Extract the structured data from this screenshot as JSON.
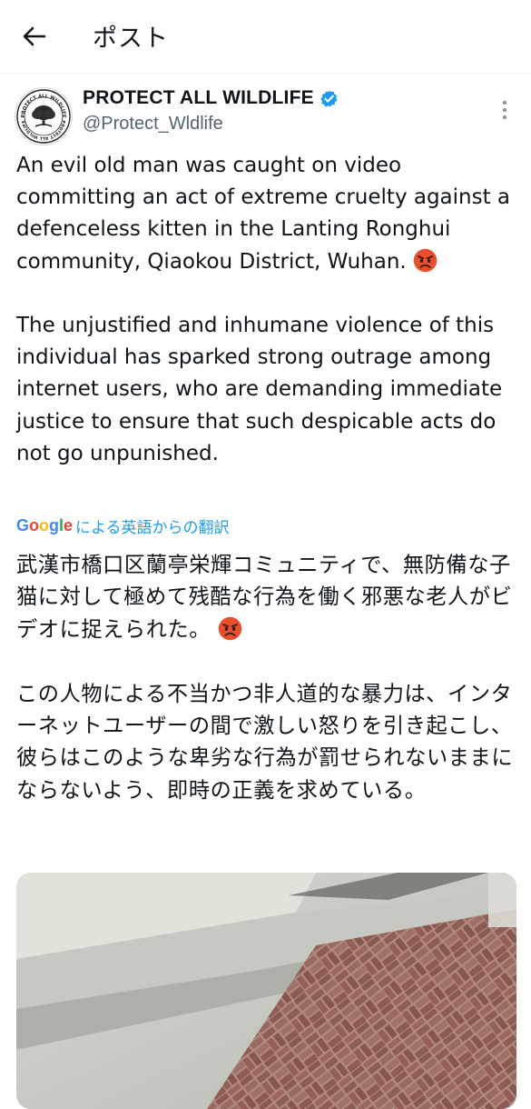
{
  "header": {
    "title": "ポスト"
  },
  "author": {
    "name": "PROTECT ALL WILDLIFE",
    "handle": "@Protect_Wldlife",
    "verified": true,
    "verified_color": "#1d9bf0",
    "avatar_seal_text": "PROTECT ALL WILDLIFE"
  },
  "post": {
    "paragraph1": "An evil old man was caught on video committing an act of extreme cruelty against a defenceless kitten in the Lanting Ronghui community, Qiaokou District, Wuhan. ",
    "paragraph2": "The unjustified and inhumane violence of this individual has sparked strong outrage among internet users, who are demanding immediate justice to ensure that such despicable acts do not go unpunished.",
    "emoji": "angry-face-emoji"
  },
  "translation": {
    "brand": "Google",
    "label": "による英語からの翻訳",
    "paragraph1": "武漢市橋口区蘭亭栄輝コミュニティで、無防備な子猫に対して極めて残酷な行為を働く邪悪な老人がビデオに捉えられた。 ",
    "paragraph2": "この人物による不当かつ非人道的な暴力は、インターネットユーザーの間で激しい怒りを引き起こし、彼らはこのような卑劣な行為が罰せられないままにならないよう、即時の正義を求めている。"
  },
  "icons": {
    "back": "arrow-left-icon",
    "more": "more-vertical-icon",
    "verified": "verified-badge-icon"
  },
  "colors": {
    "accent": "#1d9bf0",
    "secondary_text": "#536471",
    "emoji_angry": "#e8502b"
  }
}
